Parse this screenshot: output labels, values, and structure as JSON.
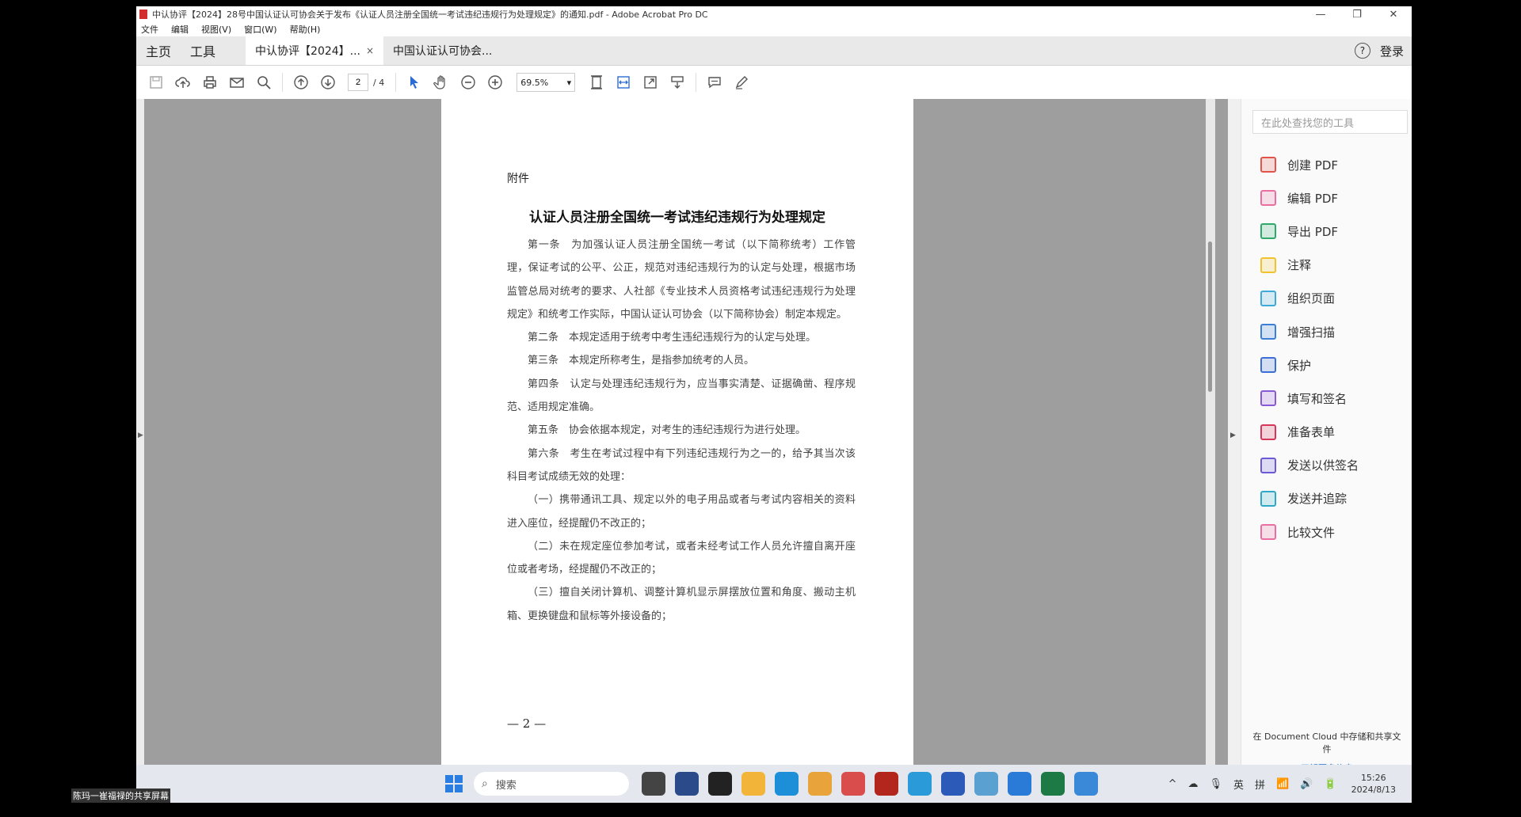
{
  "window": {
    "title": "中认协评【2024】28号中国认证认可协会关于发布《认证人员注册全国统一考试违纪违规行为处理规定》的通知.pdf - Adobe Acrobat Pro DC",
    "controls": [
      "—",
      "❐",
      "✕"
    ]
  },
  "menu": [
    "文件",
    "编辑",
    "视图(V)",
    "窗口(W)",
    "帮助(H)"
  ],
  "tabs": {
    "home": "主页",
    "tools": "工具",
    "doc_active": "中认协评【2024】...",
    "doc_close": "×",
    "doc_second": "中国认证认可协会..."
  },
  "header_right": {
    "help": "?",
    "login": "登录"
  },
  "toolbar": {
    "page_current": "2",
    "page_total": "/ 4",
    "zoom": "69.5%"
  },
  "document": {
    "attachment": "附件",
    "title": "认证人员注册全国统一考试违纪违规行为处理规定",
    "paragraphs": [
      "第一条　为加强认证人员注册全国统一考试（以下简称统考）工作管理，保证考试的公平、公正，规范对违纪违规行为的认定与处理，根据市场监管总局对统考的要求、人社部《专业技术人员资格考试违纪违规行为处理规定》和统考工作实际，中国认证认可协会（以下简称协会）制定本规定。",
      "第二条　本规定适用于统考中考生违纪违规行为的认定与处理。",
      "第三条　本规定所称考生，是指参加统考的人员。",
      "第四条　认定与处理违纪违规行为，应当事实清楚、证据确凿、程序规范、适用规定准确。",
      "第五条　协会依据本规定，对考生的违纪违规行为进行处理。",
      "第六条　考生在考试过程中有下列违纪违规行为之一的，给予其当次该科目考试成绩无效的处理：",
      "（一）携带通讯工具、规定以外的电子用品或者与考试内容相关的资料进入座位，经提醒仍不改正的；",
      "（二）未在规定座位参加考试，或者未经考试工作人员允许擅自离开座位或者考场，经提醒仍不改正的；",
      "（三）擅自关闭计算机、调整计算机显示屏摆放位置和角度、搬动主机箱、更换键盘和鼠标等外接设备的；"
    ],
    "page_number": "— 2 —"
  },
  "side_panel": {
    "search_placeholder": "在此处查找您的工具",
    "tools": [
      {
        "label": "创建 PDF",
        "color": "#e0544a"
      },
      {
        "label": "编辑 PDF",
        "color": "#e86fa0"
      },
      {
        "label": "导出 PDF",
        "color": "#2fa86b"
      },
      {
        "label": "注释",
        "color": "#f2c12e"
      },
      {
        "label": "组织页面",
        "color": "#3fa9d8"
      },
      {
        "label": "增强扫描",
        "color": "#3b7fd6"
      },
      {
        "label": "保护",
        "color": "#3b6fd6"
      },
      {
        "label": "填写和签名",
        "color": "#8a5ad6"
      },
      {
        "label": "准备表单",
        "color": "#d6365a"
      },
      {
        "label": "发送以供签名",
        "color": "#6a5ad6"
      },
      {
        "label": "发送并追踪",
        "color": "#2fa8c8"
      },
      {
        "label": "比较文件",
        "color": "#e86fa0"
      }
    ],
    "footer_text": "在 Document Cloud 中存储和共享文件",
    "footer_link": "了解更多信息"
  },
  "taskbar": {
    "search_placeholder": "搜索",
    "tray": [
      "^",
      "☁",
      "🎙",
      "英",
      "拼",
      "📶",
      "🔊",
      "🔋"
    ],
    "time": "15:26",
    "date": "2024/8/13"
  },
  "overlay_label": "陈玛一崔福禄的共享屏幕"
}
